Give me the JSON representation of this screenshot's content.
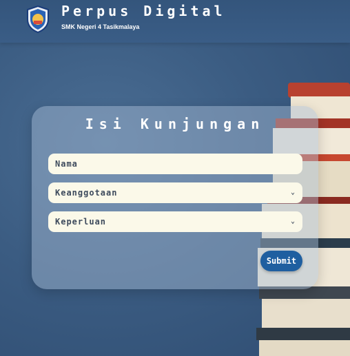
{
  "header": {
    "title": "Perpus Digital",
    "subtitle": "SMK Negeri 4 Tasikmalaya",
    "logo_icon": "school-emblem-icon"
  },
  "form": {
    "title": "Isi Kunjungan",
    "name_placeholder": "Nama",
    "membership_label": "Keanggotaan",
    "purpose_label": "Keperluan",
    "submit_label": "Submit"
  },
  "colors": {
    "accent": "#1f5fa0",
    "field_bg": "#fbf9e9",
    "background": "#3b5c82"
  }
}
